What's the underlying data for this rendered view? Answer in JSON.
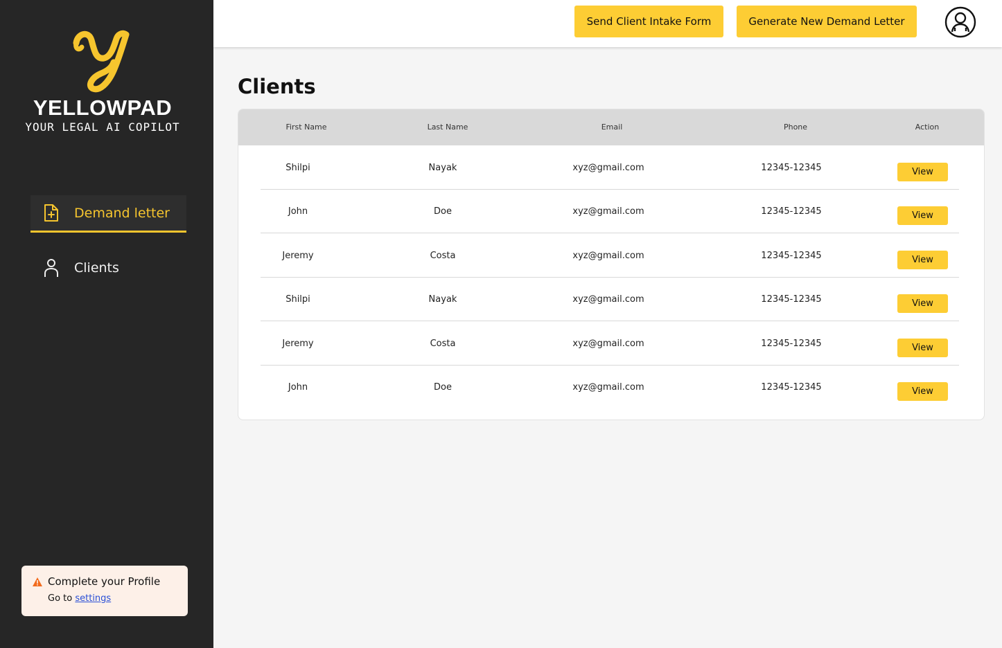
{
  "brand": {
    "name": "YELLOWPAD",
    "tagline": "YOUR LEGAL AI COPILOT",
    "accent": "#f6c52e"
  },
  "sidebar": {
    "items": [
      {
        "label": "Demand letter",
        "icon": "document-plus-icon",
        "active": true
      },
      {
        "label": "Clients",
        "icon": "user-icon",
        "active": false
      }
    ],
    "profile_card": {
      "title": "Complete your Profile",
      "sub_prefix": "Go to",
      "link": "settings",
      "icon": "warning-icon"
    }
  },
  "header": {
    "intake_button": "Send Client Intake Form",
    "generate_button": "Generate New Demand Letter",
    "avatar_icon": "user-circle-icon"
  },
  "main": {
    "title": "Clients",
    "columns": [
      "First Name",
      "Last Name",
      "Email",
      "Phone",
      "Action"
    ],
    "rows": [
      {
        "first": "Shilpi",
        "last": "Nayak",
        "email": "xyz@gmail.com",
        "phone": "12345-12345",
        "action": "View"
      },
      {
        "first": "John",
        "last": "Doe",
        "email": "xyz@gmail.com",
        "phone": "12345-12345",
        "action": "View"
      },
      {
        "first": "Jeremy",
        "last": "Costa",
        "email": "xyz@gmail.com",
        "phone": "12345-12345",
        "action": "View"
      },
      {
        "first": "Shilpi",
        "last": "Nayak",
        "email": "xyz@gmail.com",
        "phone": "12345-12345",
        "action": "View"
      },
      {
        "first": "Jeremy",
        "last": "Costa",
        "email": "xyz@gmail.com",
        "phone": "12345-12345",
        "action": "View"
      },
      {
        "first": "John",
        "last": "Doe",
        "email": "xyz@gmail.com",
        "phone": "12345-12345",
        "action": "View"
      }
    ]
  },
  "colors": {
    "sidebar_bg": "#262626",
    "button_yellow": "#fdcd34",
    "page_bg": "#f5f5f5",
    "table_header_bg": "#d9d9d9"
  }
}
